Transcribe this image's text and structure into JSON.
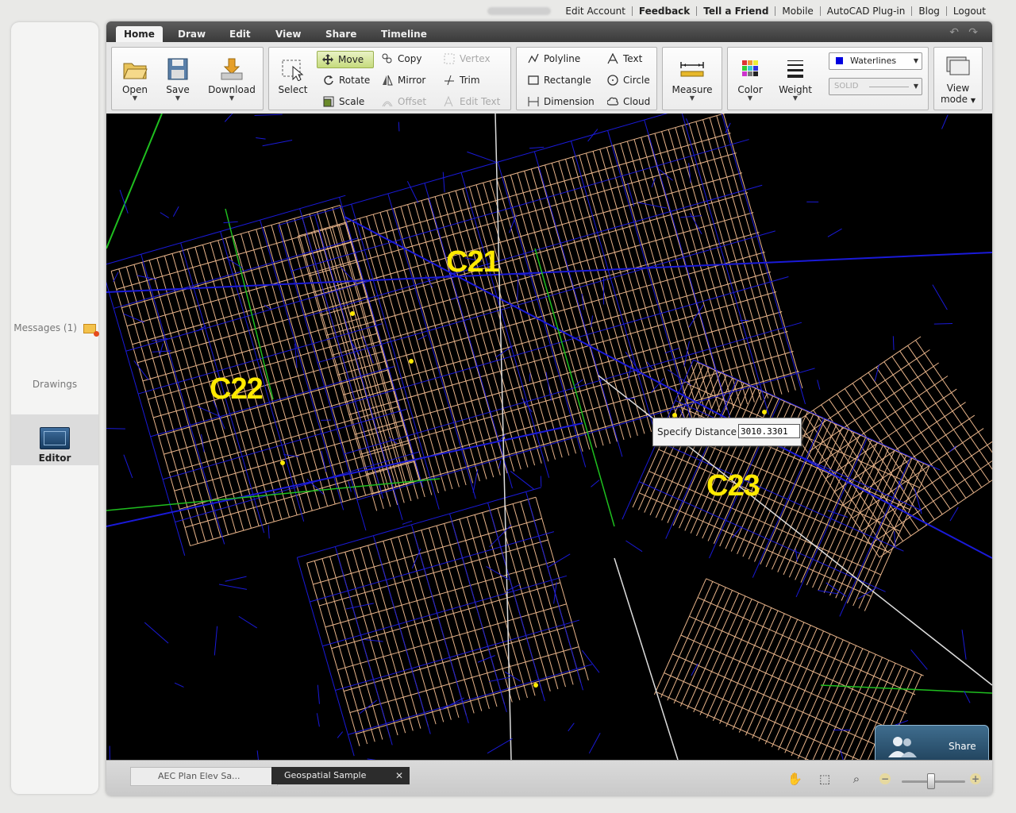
{
  "top_links": [
    {
      "label": "Edit Account",
      "bold": false
    },
    {
      "label": "Feedback",
      "bold": true
    },
    {
      "label": "Tell a Friend",
      "bold": true
    },
    {
      "label": "Mobile",
      "bold": false
    },
    {
      "label": "AutoCAD Plug-in",
      "bold": false
    },
    {
      "label": "Blog",
      "bold": false
    },
    {
      "label": "Logout",
      "bold": false
    }
  ],
  "left_panel": {
    "messages_label": "Messages (1)",
    "drawings_label": "Drawings",
    "editor_label": "Editor"
  },
  "tabs": [
    "Home",
    "Draw",
    "Edit",
    "View",
    "Share",
    "Timeline"
  ],
  "ribbon": {
    "open": "Open",
    "save": "Save",
    "download": "Download",
    "select": "Select",
    "move": "Move",
    "rotate": "Rotate",
    "scale": "Scale",
    "copy": "Copy",
    "mirror": "Mirror",
    "offset": "Offset",
    "vertex": "Vertex",
    "trim": "Trim",
    "edit_text": "Edit Text",
    "polyline": "Polyline",
    "rectangle": "Rectangle",
    "dimension": "Dimension",
    "text": "Text",
    "circle": "Circle",
    "cloud": "Cloud",
    "measure": "Measure",
    "color": "Color",
    "weight": "Weight",
    "layer_value": "Waterlines",
    "layer_color": "#0000e0",
    "linetype_value": "SOLID",
    "view_mode_line1": "View",
    "view_mode_line2": "mode"
  },
  "map": {
    "zones": [
      "C21",
      "C22",
      "C23"
    ]
  },
  "distance_prompt": {
    "label": "Specify Distance",
    "value": "3010.3301"
  },
  "share_button": "Share",
  "doc_tabs": {
    "inactive": "AEC Plan Elev Sa...",
    "active": "Geospatial Sample"
  },
  "colors": {
    "parcel": "#e8b48a",
    "street": "#1a1ad8",
    "green_line": "#1fbf1f",
    "label": "#ffea00"
  }
}
